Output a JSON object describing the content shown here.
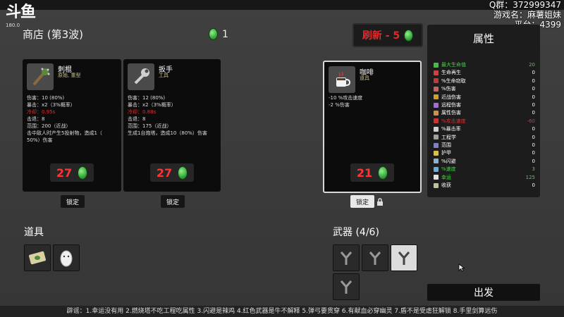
{
  "watermark": {
    "logo": "斗鱼",
    "sub": "180.0"
  },
  "overlay": {
    "line1": "Q群：372999347",
    "line2": "游戏名：麻薯姐妹",
    "line3": "平台：4399"
  },
  "shop": {
    "title": "商店 (第3波)",
    "currency_value": "1",
    "refresh_label": "刷新 - 5"
  },
  "cards": [
    {
      "name": "刺棍",
      "tag": "原始, 重型",
      "lines": [
        "伤害：10 (80%)",
        "暴击：x2（3%概率）",
        "冷却：0.95s",
        "击退：8",
        "范围：200（近战）",
        "击中敌人时产生5投射物，造成1（",
        "50%）伤害"
      ],
      "price": "27",
      "lock": "锁定"
    },
    {
      "name": "扳手",
      "tag": "工具",
      "lines": [
        "伤害：12 (80%)",
        "暴击：x2（3%概率）",
        "冷却：0.88s",
        "击退：8",
        "范围：175（近战）",
        "生成1台炮塔，造成10（80%）伤害"
      ],
      "price": "27",
      "lock": "锁定"
    },
    {
      "name": "咖啡",
      "tag": "道具",
      "lines": [
        "-10 %攻击速度",
        "-2 %伤害"
      ],
      "price": "21",
      "lock": "锁定"
    }
  ],
  "stats": {
    "title": "属性",
    "rows": [
      {
        "label": "最大生命值",
        "value": "20",
        "color": "#45d445",
        "ic": "#3bc43b"
      },
      {
        "label": "生命再生",
        "value": "0",
        "color": "#ffffff",
        "ic": "#d04040"
      },
      {
        "label": "%生命窃取",
        "value": "0",
        "color": "#ffffff",
        "ic": "#c03a3a"
      },
      {
        "label": "%伤害",
        "value": "0",
        "color": "#ffffff",
        "ic": "#d06060"
      },
      {
        "label": "近战伤害",
        "value": "0",
        "color": "#ffffff",
        "ic": "#c8a040"
      },
      {
        "label": "远程伤害",
        "value": "0",
        "color": "#ffffff",
        "ic": "#a070d0"
      },
      {
        "label": "属性伤害",
        "value": "0",
        "color": "#ffffff",
        "ic": "#d09040"
      },
      {
        "label": "%攻击速度",
        "value": "-60",
        "color": "#e03030",
        "ic": "#d03030"
      },
      {
        "label": "%暴击率",
        "value": "0",
        "color": "#ffffff",
        "ic": "#d0d0d0"
      },
      {
        "label": "工程学",
        "value": "0",
        "color": "#ffffff",
        "ic": "#a0a0a0"
      },
      {
        "label": "范围",
        "value": "0",
        "color": "#ffffff",
        "ic": "#8080d0"
      },
      {
        "label": "护甲",
        "value": "0",
        "color": "#ffffff",
        "ic": "#e0c040"
      },
      {
        "label": "%闪避",
        "value": "0",
        "color": "#ffffff",
        "ic": "#8ab0d0"
      },
      {
        "label": "%速度",
        "value": "3",
        "color": "#45d445",
        "ic": "#60b0e0"
      },
      {
        "label": "幸运",
        "value": "125",
        "color": "#45d445",
        "ic": "#e0e0e0"
      },
      {
        "label": "收获",
        "value": "0",
        "color": "#ffffff",
        "ic": "#c0c0a0"
      }
    ]
  },
  "items_title": "道具",
  "weapons_title": "武器 (4/6)",
  "go_label": "出发",
  "ticker": "辟谣：1.幸运没有用 2.燃烧塔不吃工程吃属性 3.闪避是辣鸡 4.红色武器是牛不解释 5.弹弓要贯穿 6.有献血必穿幽灵 7.盾不是受虐狂解锁 8.手里剑算远伤"
}
